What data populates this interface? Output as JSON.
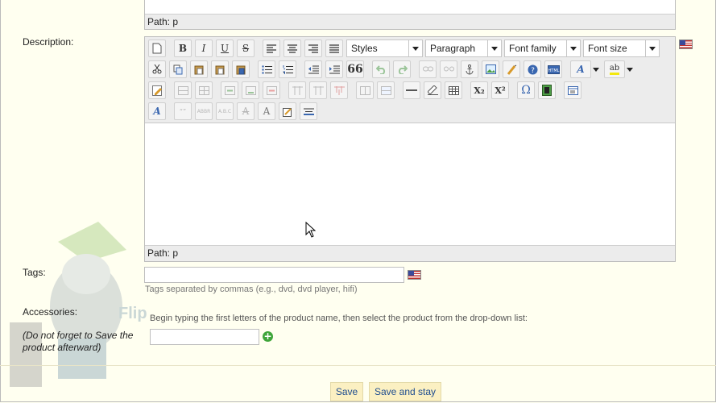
{
  "top_editor": {
    "path_label": "Path: p"
  },
  "description": {
    "label": "Description:",
    "path_label": "Path: p",
    "dropdowns": {
      "styles": "Styles",
      "format": "Paragraph",
      "font_family": "Font family",
      "font_size": "Font size"
    },
    "buttons": {
      "bold": "B",
      "italic": "I",
      "underline": "U",
      "strike": "S",
      "blockquote": "66",
      "subscript": "X₂",
      "superscript": "X²",
      "omega": "Ω",
      "font_color": "A",
      "bg_color": "ab",
      "text_style": "A"
    },
    "language_flag": "us-flag-icon"
  },
  "tags": {
    "label": "Tags:",
    "value": "",
    "hint": "Tags separated by commas (e.g., dvd, dvd player, hifi)",
    "language_flag": "us-flag-icon"
  },
  "accessories": {
    "label": "Accessories:",
    "note": "(Do not forget to Save the product afterward)",
    "instructions": "Begin typing the first letters of the product name, then select the product from the drop-down list:",
    "value": "",
    "add_icon": "add-icon"
  },
  "actions": {
    "save": "Save",
    "save_and_stay": "Save and stay"
  },
  "watermark": "FlipperHost"
}
